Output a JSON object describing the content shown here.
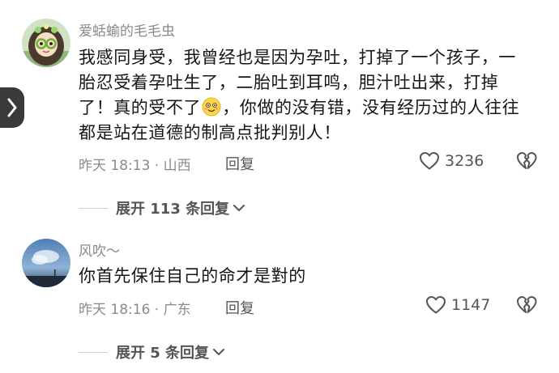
{
  "comments": [
    {
      "username": "爱蛞蝓的毛毛虫",
      "text_before_emoji": "我感同身受，我曾经也是因为孕吐，打掉了一个孩子，一胎忍受着孕吐生了，二胎吐到耳鸣，胆汁吐出来，打掉了！真的受不了",
      "emoji_icon": "smiling-face-emoji",
      "text_after_emoji": "，你做的没有错，没有经历过的人往往都是站在道德的制高点批判别人！",
      "time": "昨天 18:13",
      "location": "山西",
      "reply_label": "回复",
      "likes": "3236",
      "expand_label": "展开 113 条回复"
    },
    {
      "username": "风吹～",
      "text": "你首先保住自己的命才是對的",
      "time": "昨天 18:16",
      "location": "广东",
      "reply_label": "回复",
      "likes": "1147",
      "expand_label": "展开 5 条回复"
    }
  ],
  "icons": {
    "side_handle": "chevron-right-icon",
    "like": "heart-outline-icon",
    "dislike": "broken-heart-icon",
    "expand": "chevron-down-icon"
  },
  "colors": {
    "text": "#161616",
    "meta": "#8a8a8a",
    "handle": "#3a3a3a"
  }
}
